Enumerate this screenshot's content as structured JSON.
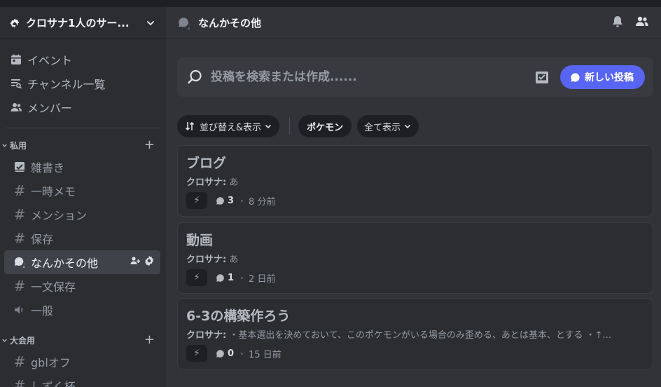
{
  "server": {
    "name": "クロサナ1人のサー..."
  },
  "nav": [
    {
      "label": "イベント",
      "icon": "calendar-icon"
    },
    {
      "label": "チャンネル一覧",
      "icon": "channel-browse-icon"
    },
    {
      "label": "メンバー",
      "icon": "members-icon"
    }
  ],
  "categories": [
    {
      "name": "私用",
      "channels": [
        {
          "label": "雑書き",
          "icon": "checklist-icon"
        },
        {
          "label": "一時メモ",
          "icon": "hash-icon"
        },
        {
          "label": "メンション",
          "icon": "hash-icon"
        },
        {
          "label": "保存",
          "icon": "hash-icon"
        },
        {
          "label": "なんかその他",
          "icon": "forum-icon",
          "active": true
        },
        {
          "label": "一文保存",
          "icon": "hash-icon"
        },
        {
          "label": "一般",
          "icon": "speaker-icon"
        }
      ]
    },
    {
      "name": "大会用",
      "channels": [
        {
          "label": "gblオフ",
          "icon": "hash-icon"
        },
        {
          "label": "しずく杯",
          "icon": "hash-icon"
        }
      ]
    }
  ],
  "channel": {
    "title": "なんかその他"
  },
  "search": {
    "placeholder": "投稿を検索または作成......"
  },
  "new_post_label": "新しい投稿",
  "filters": {
    "sort_label": "並び替え&表示",
    "tag_label": "ポケモン",
    "show_all_label": "全て表示"
  },
  "posts": [
    {
      "title": "ブログ",
      "author": "クロサナ:",
      "body": "あ",
      "reaction": "⚡",
      "count": "3",
      "time": "8 分前"
    },
    {
      "title": "動画",
      "author": "クロサナ:",
      "body": "あ",
      "reaction": "⚡",
      "count": "1",
      "time": "2 日前"
    },
    {
      "title": "6-3の構築作ろう",
      "author": "クロサナ:",
      "body": "・基本選出を決めておいて、このポケモンがいる場合のみ歪める、あとは基本、とする ・↑...",
      "reaction": "⚡",
      "count": "0",
      "time": "15 日前"
    }
  ],
  "colors": {
    "accent": "#5865f2",
    "bg_main": "#313338",
    "bg_sidebar": "#2b2d31"
  }
}
